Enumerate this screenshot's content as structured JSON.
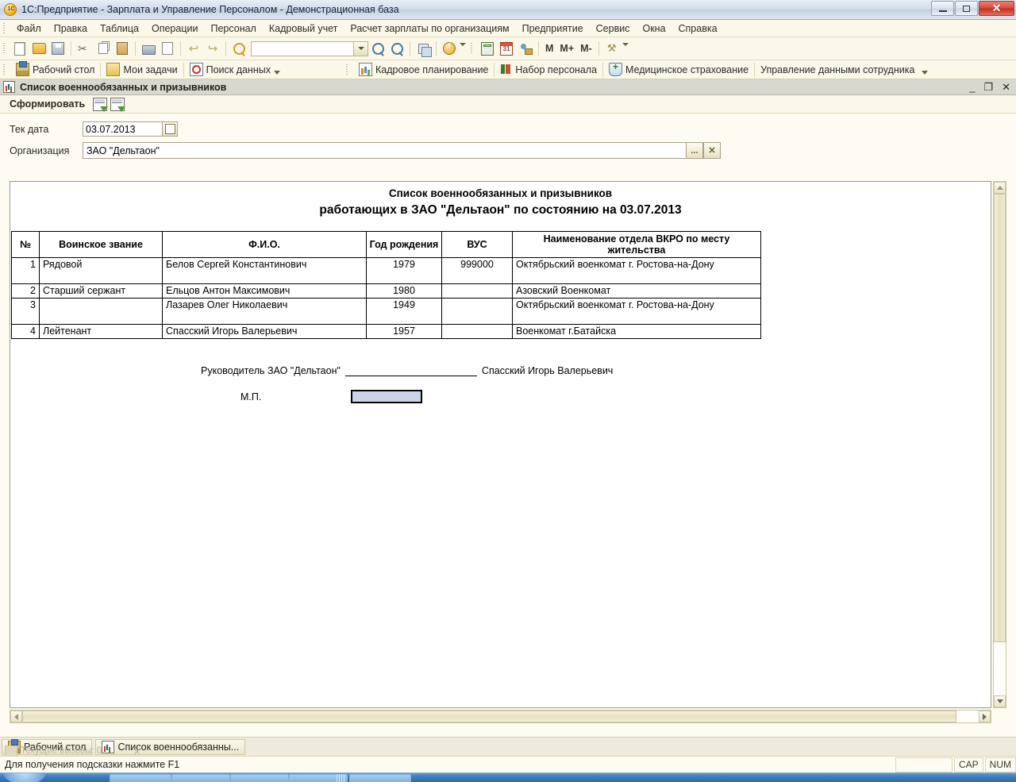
{
  "window": {
    "title": "1С:Предприятие - Зарплата и Управление Персоналом - Демонстрационная база",
    "app_icon": "1c-logo-icon",
    "minimize": "—",
    "restore": "❐",
    "close": "✕"
  },
  "menubar": {
    "items": [
      {
        "label": "Файл"
      },
      {
        "label": "Правка"
      },
      {
        "label": "Таблица"
      },
      {
        "label": "Операции"
      },
      {
        "label": "Персонал"
      },
      {
        "label": "Кадровый учет"
      },
      {
        "label": "Расчет зарплаты по организациям"
      },
      {
        "label": "Предприятие"
      },
      {
        "label": "Сервис"
      },
      {
        "label": "Окна"
      },
      {
        "label": "Справка"
      }
    ]
  },
  "toolbar": {
    "search_value": "",
    "buttons": [
      {
        "name": "new-document-icon"
      },
      {
        "name": "open-folder-icon"
      },
      {
        "name": "save-icon"
      },
      {
        "name": "cut-icon"
      },
      {
        "name": "copy-icon"
      },
      {
        "name": "paste-icon"
      },
      {
        "name": "print-icon"
      },
      {
        "name": "print-preview-icon"
      },
      {
        "name": "undo-icon"
      },
      {
        "name": "redo-icon"
      },
      {
        "name": "find-icon"
      }
    ],
    "memory": {
      "m": "M",
      "m_plus": "M+",
      "m_minus": "M-"
    }
  },
  "navpanel": {
    "left_items": [
      {
        "label": "Рабочий стол",
        "icon": "desktop-icon"
      },
      {
        "label": "Мои задачи",
        "icon": "tasks-note-icon"
      },
      {
        "label": "Поиск данных",
        "icon": "data-search-icon"
      }
    ],
    "right_items": [
      {
        "label": "Кадровое планирование",
        "icon": "staff-planning-icon"
      },
      {
        "label": "Набор персонала",
        "icon": "recruitment-icon"
      },
      {
        "label": "Медицинское страхование",
        "icon": "medical-insurance-icon"
      },
      {
        "label": "Управление данными сотрудника",
        "icon": "employee-data-icon"
      }
    ]
  },
  "mdi": {
    "title": "Список военнообязанных и призывников",
    "title_icon": "report-chart-icon",
    "minimize": "_",
    "restore": "❐",
    "close": "✕",
    "form_button": "Сформировать"
  },
  "params": {
    "date_label": "Тек дата",
    "date_value": "03.07.2013",
    "org_label": "Организация",
    "org_value": "ЗАО \"Дельтаон\"",
    "org_select_button": "...",
    "org_clear_button": "✕"
  },
  "report": {
    "title_line1": "Список военнообязанных и призывников",
    "title_line2": "работающих в ЗАО \"Дельтаон\" по состоянию на  03.07.2013",
    "columns": [
      "№",
      "Воинское звание",
      "Ф.И.О.",
      "Год рождения",
      "ВУС",
      "Наименование отдела ВКРО по месту жительства"
    ],
    "rows": [
      {
        "num": "1",
        "rank": "Рядовой",
        "fio": "Белов Сергей Константинович",
        "year": "1979",
        "vus": "999000",
        "dept": "Октябрьский военкомат г. Ростова-на-Дону",
        "tall": true
      },
      {
        "num": "2",
        "rank": "Старший сержант",
        "fio": "Ельцов Антон Максимович",
        "year": "1980",
        "vus": "",
        "dept": "Азовский Военкомат",
        "tall": false
      },
      {
        "num": "3",
        "rank": "",
        "fio": "Лазарев Олег Николаевич",
        "year": "1949",
        "vus": "",
        "dept": "Октябрьский военкомат г. Ростова-на-Дону",
        "tall": true
      },
      {
        "num": "4",
        "rank": "Лейтенант",
        "fio": "Спасский Игорь Валерьевич",
        "year": "1957",
        "vus": "",
        "dept": "Военкомат г.Батайска",
        "tall": false
      }
    ],
    "signature": {
      "label": "Руководитель ЗАО \"Дельтаон\"",
      "name": "Спасский Игорь Валерьевич",
      "stamp_label": "М.П."
    }
  },
  "app_taskbar": {
    "tasks": [
      {
        "label": "Рабочий стол",
        "icon": "desktop-icon"
      },
      {
        "label": "Список военнообязанны...",
        "icon": "report-chart-icon"
      }
    ],
    "ghost_text": "Текущие вызовы: 0",
    "ghost_close": "✕"
  },
  "statusbar": {
    "hint": "Для получения подсказки нажмите F1",
    "caps": "CAP",
    "num": "NUM"
  },
  "colors": {
    "titlebar_accent": "#c6d0e0",
    "close_button": "#c02e20",
    "toolbar_bg": "#fbf8e9",
    "sheet_bg": "#ffffff",
    "selected_cell": "#ccd4e8",
    "taskbar_blue": "#3f7cb8"
  }
}
